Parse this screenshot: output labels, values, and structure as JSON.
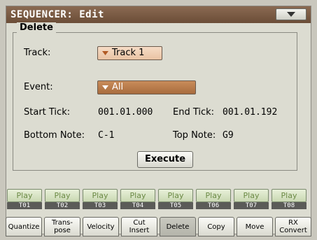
{
  "header": {
    "title": "SEQUENCER: Edit"
  },
  "section": {
    "title": "Delete"
  },
  "track": {
    "label": "Track:",
    "value": "Track 1"
  },
  "event": {
    "label": "Event:",
    "value": "All"
  },
  "start_tick": {
    "label": "Start Tick:",
    "value": "001.01.000"
  },
  "end_tick": {
    "label": "End Tick:",
    "value": "001.01.192"
  },
  "bottom_note": {
    "label": "Bottom Note:",
    "value": "C-1"
  },
  "top_note": {
    "label": "Top Note:",
    "value": "G9"
  },
  "execute": {
    "label": "Execute"
  },
  "tracks": [
    {
      "play": "Play",
      "name": "T01"
    },
    {
      "play": "Play",
      "name": "T02"
    },
    {
      "play": "Play",
      "name": "T03"
    },
    {
      "play": "Play",
      "name": "T04"
    },
    {
      "play": "Play",
      "name": "T05"
    },
    {
      "play": "Play",
      "name": "T06"
    },
    {
      "play": "Play",
      "name": "T07"
    },
    {
      "play": "Play",
      "name": "T08"
    }
  ],
  "tabs": [
    {
      "label": "Quantize"
    },
    {
      "label": "Trans-\npose"
    },
    {
      "label": "Velocity"
    },
    {
      "label": "Cut\nInsert"
    },
    {
      "label": "Delete",
      "active": true
    },
    {
      "label": "Copy"
    },
    {
      "label": "Move"
    },
    {
      "label": "RX\nConvert"
    }
  ],
  "icons": {
    "menu": "triangle-down-icon",
    "combo_arrow": "triangle-down-icon"
  },
  "colors": {
    "title_bar": "#7a5a43",
    "combo_light": "#f0cfb4",
    "combo_dark": "#b87a48",
    "play_text": "#6b8a45"
  }
}
